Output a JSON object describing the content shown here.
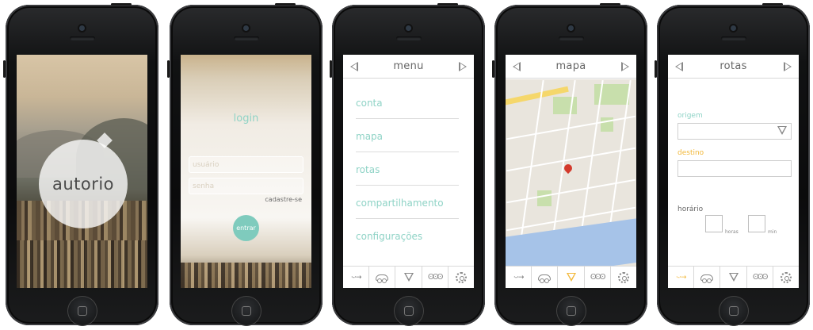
{
  "splash": {
    "logo": "autorio"
  },
  "login": {
    "title": "login",
    "username_placeholder": "usuário",
    "password_placeholder": "senha",
    "register_link": "cadastre-se",
    "submit_label": "entrar"
  },
  "menu": {
    "title": "menu",
    "items": [
      "conta",
      "mapa",
      "rotas",
      "compartilhamento",
      "configurações"
    ]
  },
  "map_screen": {
    "title": "mapa"
  },
  "routes": {
    "title": "rotas",
    "origin_label": "origem",
    "destination_label": "destino",
    "time_label": "horário",
    "hours_label": "horas",
    "minutes_label": "min"
  },
  "tabbar": {
    "arrow_glyph": "·-·→",
    "people_glyph": "ʘʘʘ"
  },
  "icons": {
    "back": "left-triangle-icon",
    "forward": "right-triangle-icon",
    "route": "arrow-dots-icon",
    "car": "car-icon",
    "filter": "funnel-icon",
    "share": "people-icon",
    "settings": "gear-icon"
  },
  "colors": {
    "accent_teal": "#8fd3c6",
    "accent_orange": "#f2b83a",
    "button_teal": "#7fcbbd"
  }
}
